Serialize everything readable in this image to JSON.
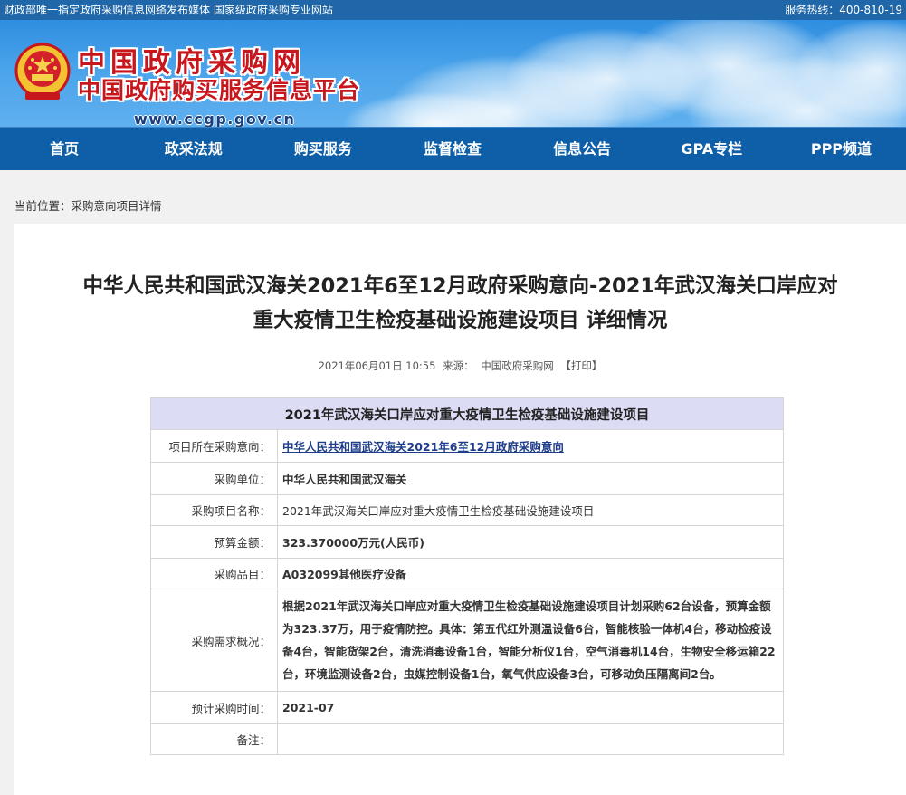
{
  "topbar": {
    "left": "财政部唯一指定政府采购信息网络发布媒体 国家级政府采购专业网站",
    "right": "服务热线：400-810-19"
  },
  "logo": {
    "line1": "中国政府采购网",
    "line2": "中国政府购买服务信息平台",
    "url": "www.ccgp.gov.cn"
  },
  "nav": [
    "首页",
    "政采法规",
    "购买服务",
    "监督检查",
    "信息公告",
    "GPA专栏",
    "PPP频道"
  ],
  "breadcrumb": "当前位置：采购意向项目详情",
  "article": {
    "title_line1": "中华人民共和国武汉海关2021年6至12月政府采购意向-2021年武汉海关口岸应对",
    "title_line2": "重大疫情卫生检疫基础设施建设项目 详细情况",
    "date": "2021年06月01日 10:55",
    "source_label": "来源：",
    "source": "中国政府采购网",
    "print": "【打印】"
  },
  "table": {
    "header": "2021年武汉海关口岸应对重大疫情卫生检疫基础设施建设项目",
    "rows": [
      {
        "label": "项目所在采购意向：",
        "value": "中华人民共和国武汉海关2021年6至12月政府采购意向"
      },
      {
        "label": "采购单位：",
        "value": "中华人民共和国武汉海关"
      },
      {
        "label": "采购项目名称：",
        "value": "2021年武汉海关口岸应对重大疫情卫生检疫基础设施建设项目"
      },
      {
        "label": "预算金额：",
        "value": "323.370000万元(人民币)"
      },
      {
        "label": "采购品目：",
        "value": "A032099其他医疗设备"
      },
      {
        "label": "采购需求概况：",
        "value": "根据2021年武汉海关口岸应对重大疫情卫生检疫基础设施建设项目计划采购62台设备，预算金额为323.37万，用于疫情防控。具体：第五代红外测温设备6台，智能核验一体机4台，移动检疫设备4台，智能货架2台，清洗消毒设备1台，智能分析仪1台，空气消毒机14台，生物安全移运箱22台，环境监测设备2台，虫媒控制设备1台，氧气供应设备3台，可移动负压隔离间2台。"
      },
      {
        "label": "预计采购时间：",
        "value": "2021-07"
      },
      {
        "label": "备注：",
        "value": ""
      }
    ]
  },
  "colors": {
    "topbar": "#1f67a8",
    "nav": "#0e5fa7",
    "logo_red": "#c8161d",
    "table_header": "#dcdcf5",
    "link": "#1d3c8a"
  }
}
